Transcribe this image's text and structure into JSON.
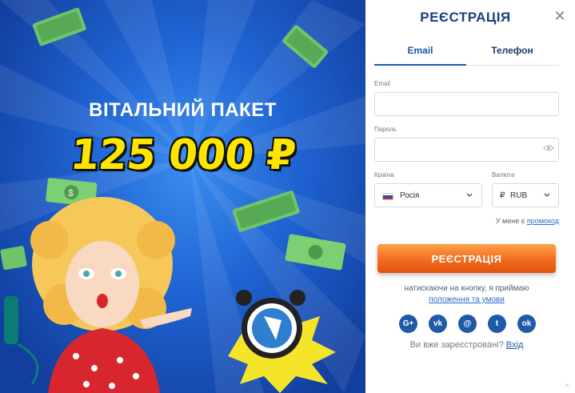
{
  "promo": {
    "heading": "ВІТАЛЬНИЙ ПАКЕТ",
    "amount": "125 000 ₽"
  },
  "registration": {
    "title": "РЕЄСТРАЦІЯ",
    "close_icon": "close-icon",
    "tabs": [
      {
        "label": "Email",
        "active": true
      },
      {
        "label": "Телефон",
        "active": false
      }
    ],
    "email": {
      "label": "Email",
      "value": "",
      "placeholder": ""
    },
    "password": {
      "label": "Пароль",
      "value": "",
      "placeholder": ""
    },
    "country": {
      "label": "Країна",
      "value": "Росія"
    },
    "currency": {
      "label": "Валюта",
      "value": "RUB",
      "symbol": "₽"
    },
    "promo_prefix": "У мене є",
    "promo_link": "промокод",
    "submit_label": "РЕЄСТРАЦІЯ",
    "terms_text": "натискаючи на кнопку, я приймаю",
    "terms_link": "положення та умови",
    "socials": [
      {
        "name": "google-plus",
        "glyph": "G+"
      },
      {
        "name": "vk",
        "glyph": "vk"
      },
      {
        "name": "email",
        "glyph": "@"
      },
      {
        "name": "twitter",
        "glyph": "t"
      },
      {
        "name": "odnoklassniki",
        "glyph": "ok"
      }
    ],
    "already_text": "Ви вже зареєстровані?",
    "login_link": "Вхід"
  },
  "colors": {
    "primary": "#1f5aa8",
    "title": "#1a3f7f",
    "accent_orange": "#f26b1e",
    "promo_yellow": "#ffe600",
    "promo_blue": "#1f63d2"
  }
}
